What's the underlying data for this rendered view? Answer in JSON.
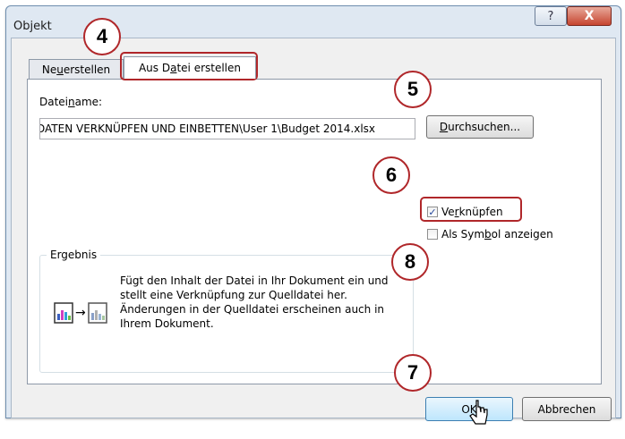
{
  "window": {
    "title": "Objekt",
    "help_glyph": "?",
    "close_glyph": "X"
  },
  "tabs": [
    {
      "label_pre": "Ne",
      "label_key": "u",
      "label_post": " erstellen"
    },
    {
      "label_pre": "Aus D",
      "label_key": "a",
      "label_post": "tei erstellen"
    }
  ],
  "filename": {
    "label_pre": "Datei",
    "label_key": "n",
    "label_post": "ame:",
    "value": "DATEN VERKNÜPFEN UND EINBETTEN\\User 1\\Budget 2014.xlsx"
  },
  "browse_button": {
    "label_pre": "",
    "label_key": "D",
    "label_post": "urchsuchen..."
  },
  "options": {
    "link": {
      "label_pre": "Ve",
      "label_key": "r",
      "label_post": "knüpfen",
      "checked": true,
      "check_glyph": "✓"
    },
    "icon": {
      "label_pre": "Als Sym",
      "label_key": "b",
      "label_post": "ol anzeigen",
      "checked": false
    }
  },
  "result": {
    "legend": "Ergebnis",
    "text": "Fügt den Inhalt der Datei in Ihr Dokument ein und stellt eine Verknüpfung zur Quelldatei her. Änderungen in der Quelldatei erscheinen auch in Ihrem Dokument.",
    "arrow_glyph": "→"
  },
  "buttons": {
    "ok": "OK",
    "cancel": "Abbrechen"
  },
  "callouts": [
    "4",
    "5",
    "6",
    "7",
    "8"
  ],
  "colors": {
    "callout": "#b0272a",
    "accent": "#3c7fb1"
  }
}
